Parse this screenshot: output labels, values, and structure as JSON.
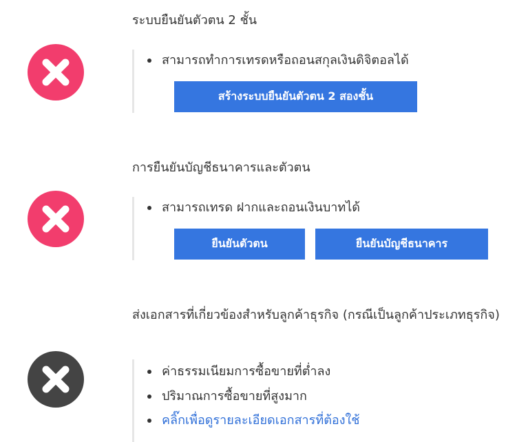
{
  "steps": [
    {
      "title": "ระบบยืนยันตัวตน 2 ชั้น",
      "status": "incomplete",
      "icon": "x-circle-icon",
      "icon_color": "#f23d6d",
      "bullets": [
        "สามารถทำการเทรดหรือถอนสกุลเงินดิจิตอลได้"
      ],
      "buttons": [
        "สร้างระบบยืนยันตัวตน 2 สองชั้น"
      ]
    },
    {
      "title": "การยืนยันบัญชีธนาคารและตัวตน",
      "status": "incomplete",
      "icon": "x-circle-icon",
      "icon_color": "#f23d6d",
      "bullets": [
        "สามารถเทรด ฝากและถอนเงินบาทได้"
      ],
      "buttons": [
        "ยืนยันตัวตน",
        "ยืนยันบัญชีธนาคาร"
      ]
    },
    {
      "title": "ส่งเอกสารที่เกี่ยวข้องสำหรับลูกค้าธุรกิจ (กรณีเป็นลูกค้าประเภทธุรกิจ)",
      "status": "incomplete",
      "icon": "x-circle-icon",
      "icon_color": "#444444",
      "bullets": [
        "ค่าธรรมเนียมการซื้อขายที่ต่ำลง",
        "ปริมาณการซื้อขายที่สูงมาก"
      ],
      "link": "คลิ๊กเพื่อดูรายละเอียดเอกสารที่ต้องใช้"
    }
  ],
  "colors": {
    "accent": "#3576e0",
    "link": "#2f6fd8",
    "divider": "#e6e6e6",
    "text": "#333333"
  }
}
